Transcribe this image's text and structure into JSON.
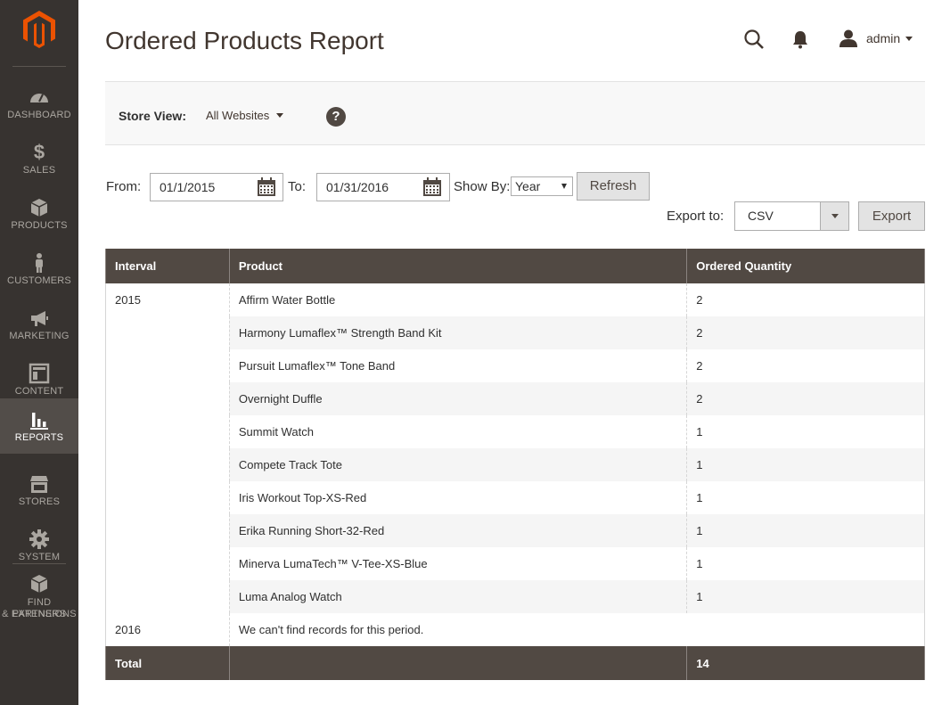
{
  "sidebar": {
    "items": [
      {
        "label": "Dashboard",
        "icon": "dashboard-icon"
      },
      {
        "label": "$",
        "text_icon": true,
        "label2": "Sales",
        "icon": "dollar-icon"
      },
      {
        "label": "Products",
        "icon": "box-icon"
      },
      {
        "label": "Customers",
        "icon": "person-icon"
      },
      {
        "label": "Marketing",
        "icon": "megaphone-icon"
      },
      {
        "label": "Content",
        "icon": "layout-icon"
      },
      {
        "label": "Reports",
        "icon": "bar-chart-icon",
        "active": true
      },
      {
        "label": "Stores",
        "icon": "storefront-icon"
      },
      {
        "label": "System",
        "icon": "gear-icon"
      },
      {
        "label": "Find Partners",
        "label2": "& Extensions",
        "icon": "extensions-icon"
      }
    ],
    "colors": {
      "background": "#373330",
      "active": "#524d49",
      "logo": "#eb5202"
    }
  },
  "header": {
    "title": "Ordered Products Report",
    "user": "admin"
  },
  "store_view": {
    "label": "Store View:",
    "selected": "All Websites",
    "help": "?"
  },
  "filters": {
    "from_label": "From:",
    "from_value": "01/1/2015",
    "to_label": "To:",
    "to_value": "01/31/2016",
    "show_by_label": "Show By:",
    "show_by_value": "Year",
    "refresh_label": "Refresh",
    "export_label": "Export to:",
    "export_value": "CSV",
    "export_button": "Export"
  },
  "table": {
    "headers": [
      "Interval",
      "Product",
      "Ordered Quantity"
    ],
    "groups": [
      {
        "interval": "2015",
        "rows": [
          {
            "product": "Affirm Water Bottle",
            "qty": "2"
          },
          {
            "product": "Harmony Lumaflex™ Strength Band Kit",
            "qty": "2"
          },
          {
            "product": "Pursuit Lumaflex™ Tone Band",
            "qty": "2"
          },
          {
            "product": "Overnight Duffle",
            "qty": "2"
          },
          {
            "product": "Summit Watch",
            "qty": "1"
          },
          {
            "product": "Compete Track Tote",
            "qty": "1"
          },
          {
            "product": "Iris Workout Top-XS-Red",
            "qty": "1"
          },
          {
            "product": "Erika Running Short-32-Red",
            "qty": "1"
          },
          {
            "product": "Minerva LumaTech™ V-Tee-XS-Blue",
            "qty": "1"
          },
          {
            "product": "Luma Analog Watch",
            "qty": "1"
          }
        ]
      },
      {
        "interval": "2016",
        "empty_message": "We can't find records for this period."
      }
    ],
    "total_label": "Total",
    "total_qty": "14"
  }
}
